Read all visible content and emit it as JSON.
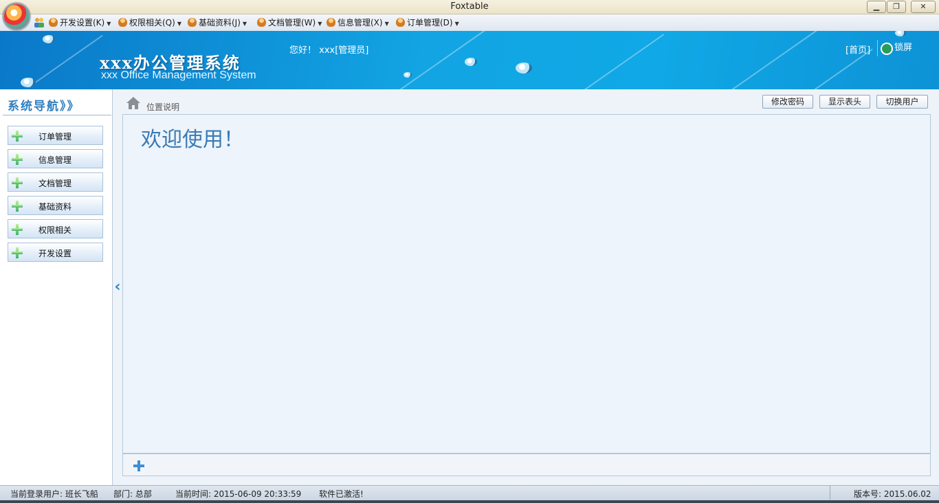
{
  "window": {
    "title": "Foxtable"
  },
  "menu": [
    {
      "label": "开发设置(K)"
    },
    {
      "label": "权限相关(Q)"
    },
    {
      "label": "基础资料(J)"
    },
    {
      "label": "文档管理(W)"
    },
    {
      "label": "信息管理(X)"
    },
    {
      "label": "订单管理(D)"
    }
  ],
  "header": {
    "title": "xxx办公管理系统",
    "subtitle": "xxx Office Management System",
    "greeting": "您好！ xxx[管理员]",
    "home_link": "[首页]",
    "lock_label": "锁屏"
  },
  "sidebar": {
    "title": "系统导航》》",
    "items": [
      {
        "label": "订单管理"
      },
      {
        "label": "信息管理"
      },
      {
        "label": "文档管理"
      },
      {
        "label": "基础资料"
      },
      {
        "label": "权限相关"
      },
      {
        "label": "开发设置"
      }
    ]
  },
  "content": {
    "location_label": "位置说明",
    "buttons": {
      "change_password": "修改密码",
      "show_header": "显示表头",
      "switch_user": "切换用户"
    },
    "welcome": "欢迎使用！"
  },
  "status": {
    "user": "当前登录用户: 班长飞船",
    "department": "部门: 总部",
    "time": "当前时间: 2015-06-09 20:33:59",
    "activation": "软件已激活!",
    "version": "版本号: 2015.06.02"
  },
  "colors": {
    "banner": "#12a4e3",
    "nav_title": "#2f7fc0",
    "welcome": "#3a7ab4"
  }
}
